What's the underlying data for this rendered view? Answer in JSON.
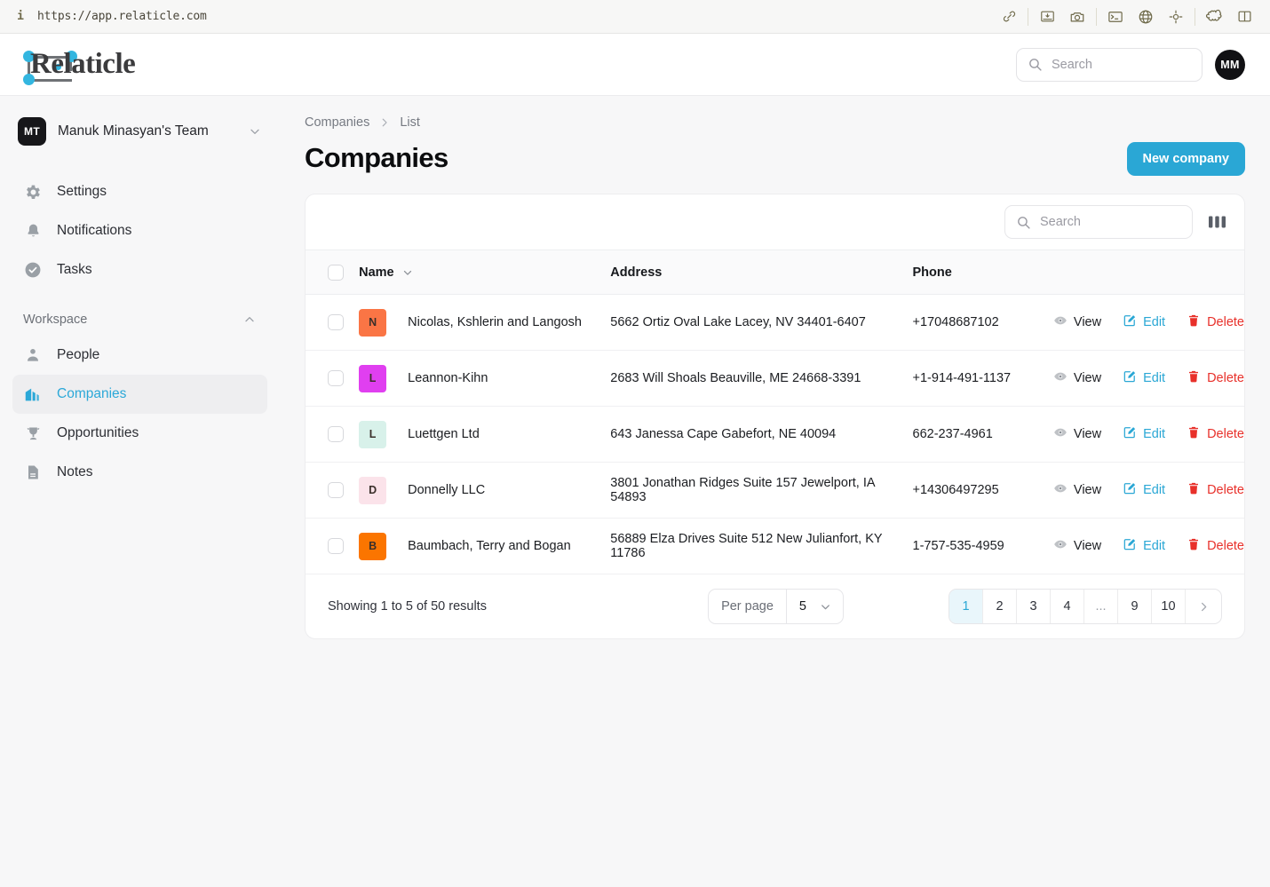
{
  "browser": {
    "info_icon": "info-icon",
    "url": "https://app.relaticle.com",
    "toolbar_icons": [
      "link-icon",
      "image-download-icon",
      "camera-icon",
      "terminal-icon",
      "globe-icon",
      "crosshair-target-icon",
      "puzzle-piece-icon",
      "split-pane-icon"
    ]
  },
  "header": {
    "logo_text": "Relaticle",
    "search": {
      "placeholder": "Search",
      "value": "",
      "icon": "search-icon"
    },
    "avatar_initials": "MM"
  },
  "sidebar": {
    "team": {
      "initials": "MT",
      "name": "Manuk Minasyan's Team",
      "chevron": "chevron-down-icon"
    },
    "top_items": [
      {
        "label": "Settings",
        "icon": "gear-icon"
      },
      {
        "label": "Notifications",
        "icon": "bell-icon"
      },
      {
        "label": "Tasks",
        "icon": "check-circle-icon"
      }
    ],
    "section": {
      "label": "Workspace",
      "chevron": "chevron-up-icon"
    },
    "workspace_items": [
      {
        "label": "People",
        "icon": "person-icon",
        "active": false
      },
      {
        "label": "Companies",
        "icon": "building-icon",
        "active": true
      },
      {
        "label": "Opportunities",
        "icon": "trophy-icon",
        "active": false
      },
      {
        "label": "Notes",
        "icon": "document-icon",
        "active": false
      }
    ]
  },
  "main": {
    "breadcrumb": {
      "root": "Companies",
      "separator": "chevron-right-icon",
      "current": "List"
    },
    "page_title": "Companies",
    "new_button": "New company",
    "toolbar": {
      "search": {
        "placeholder": "Search",
        "value": "",
        "icon": "search-icon"
      },
      "columns_icon": "columns-icon"
    },
    "table": {
      "headers": {
        "name": "Name",
        "address": "Address",
        "phone": "Phone"
      },
      "sort_icon": "chevron-down-icon",
      "rows": [
        {
          "initial": "N",
          "avatar_color": "#fa7545",
          "name": "Nicolas, Kshlerin and Langosh",
          "address": "5662 Ortiz Oval Lake Lacey, NV 34401-6407",
          "phone": "+17048687102"
        },
        {
          "initial": "L",
          "avatar_color": "#e03ff0",
          "name": "Leannon-Kihn",
          "address": "2683 Will Shoals Beauville, ME 24668-3391",
          "phone": "+1-914-491-1137"
        },
        {
          "initial": "L",
          "avatar_color": "#d8f1ea",
          "name": "Luettgen Ltd",
          "address": "643 Janessa Cape Gabefort, NE 40094",
          "phone": "662-237-4961"
        },
        {
          "initial": "D",
          "avatar_color": "#fbe3ea",
          "name": "Donnelly LLC",
          "address": "3801 Jonathan Ridges Suite 157 Jewelport, IA 54893",
          "phone": "+14306497295"
        },
        {
          "initial": "B",
          "avatar_color": "#fb7500",
          "name": "Baumbach, Terry and Bogan",
          "address": "56889 Elza Drives Suite 512 New Julianfort, KY 11786",
          "phone": "1-757-535-4959"
        }
      ],
      "actions": {
        "view": "View",
        "edit": "Edit",
        "delete": "Delete"
      }
    },
    "footer": {
      "showing": "Showing 1 to 5 of 50 results",
      "per_page_label": "Per page",
      "per_page_value": "5",
      "per_page_chevron": "chevron-down-icon",
      "pages": [
        "1",
        "2",
        "3",
        "4",
        "...",
        "9",
        "10"
      ],
      "active_page": "1",
      "next_icon": "chevron-right-icon"
    }
  },
  "colors": {
    "accent": "#2aa7d5",
    "danger": "#e8302a",
    "active_page_bg": "#e9f6fb"
  }
}
